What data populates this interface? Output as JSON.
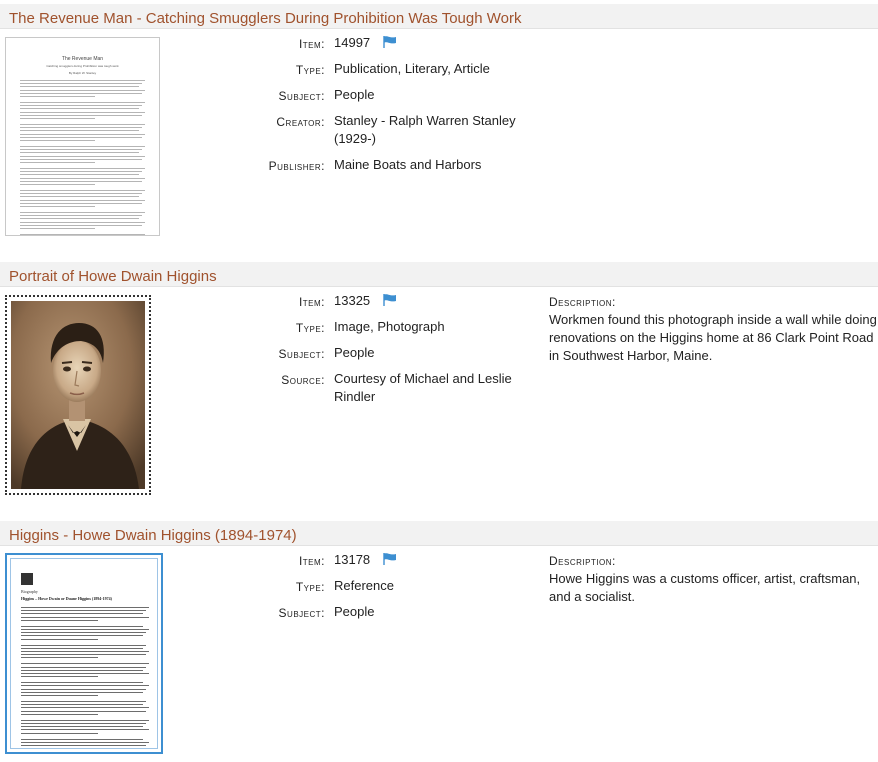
{
  "entries": [
    {
      "title": "The Revenue Man - Catching Smugglers During Prohibition Was Tough Work",
      "thumb": {
        "doc_title": "The Revenue Man",
        "doc_subtitle": "Catching smugglers during Prohibition was tough work",
        "doc_byline": "By Ralph W. Stanley"
      },
      "fields": [
        {
          "label": "Item:",
          "value": "14997"
        },
        {
          "label": "Type:",
          "value": "Publication, Literary, Article"
        },
        {
          "label": "Subject:",
          "value": "People"
        },
        {
          "label": "Creator:",
          "value": "Stanley - Ralph Warren Stanley (1929-)"
        },
        {
          "label": "Publisher:",
          "value": "Maine Boats and Harbors"
        }
      ]
    },
    {
      "title": "Portrait of Howe Dwain Higgins",
      "fields": [
        {
          "label": "Item:",
          "value": "13325"
        },
        {
          "label": "Type:",
          "value": "Image, Photograph"
        },
        {
          "label": "Subject:",
          "value": "People"
        },
        {
          "label": "Source:",
          "value": "Courtesy of Michael and Leslie Rindler"
        }
      ],
      "description_label": "Description:",
      "description": "Workmen found this photograph inside a wall while doing renovations on the Higgins home at 86 Clark Point Road in Southwest Harbor, Maine."
    },
    {
      "title": "Higgins - Howe Dwain Higgins (1894-1974)",
      "thumb": {
        "doc_heading": "Biography",
        "doc_title": "Higgins – Howe Dwain or Duane Higgins (1894-1974)"
      },
      "fields": [
        {
          "label": "Item:",
          "value": "13178"
        },
        {
          "label": "Type:",
          "value": "Reference"
        },
        {
          "label": "Subject:",
          "value": "People"
        }
      ],
      "description_label": "Description:",
      "description": "Howe Higgins was a customs officer, artist, craftsman, and a socialist."
    }
  ],
  "colors": {
    "title": "#a0522d",
    "flag": "#3d8fd1",
    "title_bar": "#f2f2f2"
  }
}
